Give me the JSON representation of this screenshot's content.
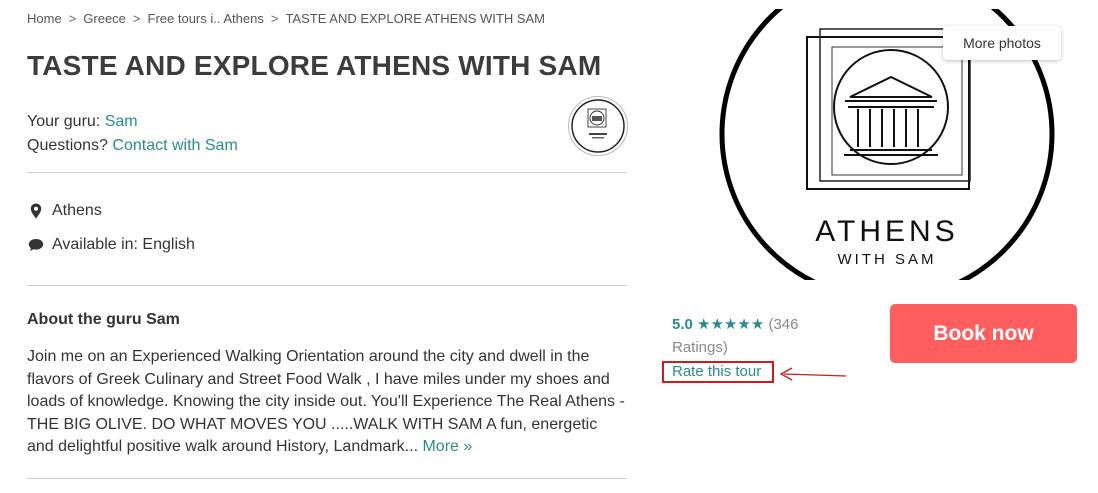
{
  "breadcrumb": [
    {
      "label": "Home"
    },
    {
      "label": "Greece"
    },
    {
      "label": "Free tours i.. Athens"
    },
    {
      "label": "TASTE AND EXPLORE ATHENS WITH SAM"
    }
  ],
  "tour": {
    "title": "TASTE AND EXPLORE ATHENS WITH SAM",
    "guru_label": "Your guru:",
    "guru_name": "Sam",
    "questions_label": "Questions?",
    "contact_label": "Contact with Sam",
    "location": "Athens",
    "languages": "Available in: English"
  },
  "about": {
    "heading": "About the guru Sam",
    "text": "Join me on an Experienced Walking Orientation around the city and dwell in the flavors of Greek Culinary and Street Food Walk , I have miles under my shoes and loads of knowledge. Knowing the city inside out. You'll Experience The Real Athens - THE BIG OLIVE. DO WHAT MOVES YOU .....WALK WITH SAM A fun, energetic and delightful positive walk around History, Landmark...",
    "more_label": "More »"
  },
  "gallery": {
    "more_photos_label": "More photos",
    "logo_line1": "ATHENS",
    "logo_line2": "WITH SAM"
  },
  "rating": {
    "score": "5.0",
    "stars": "★★★★★",
    "count": "(346 Ratings)",
    "star_value": 5,
    "rate_label": "Rate this tour"
  },
  "booking": {
    "book_label": "Book now",
    "accent": "#fe5e5e",
    "link_color": "#2a8c8c"
  }
}
